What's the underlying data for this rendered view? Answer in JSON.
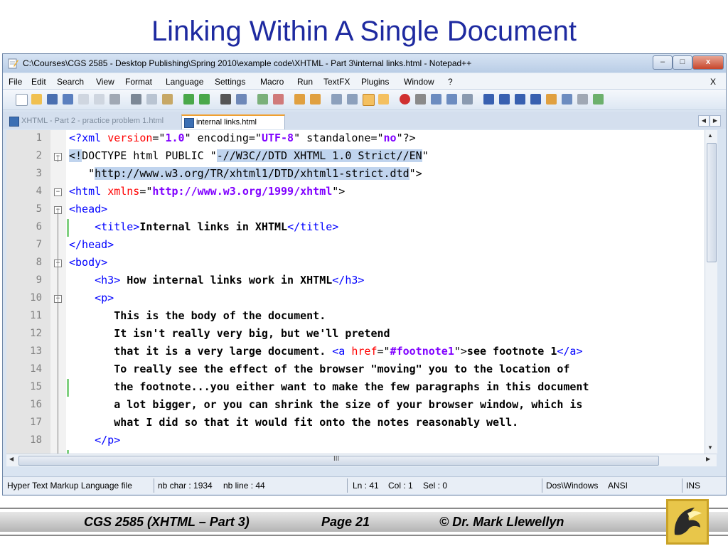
{
  "slide": {
    "title": "Linking Within A Single Document"
  },
  "window": {
    "title": "C:\\Courses\\CGS 2585 - Desktop Publishing\\Spring 2010\\example code\\XHTML - Part 3\\internal links.html - Notepad++",
    "controls": {
      "minimize": "–",
      "maximize": "□",
      "close": "x"
    }
  },
  "menu": {
    "items": [
      "File",
      "Edit",
      "Search",
      "View",
      "Format",
      "Language",
      "Settings",
      "Macro",
      "Run",
      "TextFX",
      "Plugins",
      "Window",
      "?"
    ],
    "close_doc": "X"
  },
  "tabs": [
    {
      "label": "XHTML - Part 2 - practice problem 1.html",
      "active": false
    },
    {
      "label": "internal links.html",
      "active": true
    }
  ],
  "editor": {
    "line_numbers": [
      "1",
      "2",
      "3",
      "4",
      "5",
      "6",
      "7",
      "8",
      "9",
      "10",
      "11",
      "12",
      "13",
      "14",
      "15",
      "16",
      "17",
      "18"
    ],
    "lines": [
      [
        {
          "t": "<?",
          "c": "tag"
        },
        {
          "t": "xml ",
          "c": "tag"
        },
        {
          "t": "version",
          "c": "attr"
        },
        {
          "t": "=\"",
          "c": ""
        },
        {
          "t": "1.0",
          "c": "val"
        },
        {
          "t": "\" encoding=\"",
          "c": ""
        },
        {
          "t": "UTF-8",
          "c": "val"
        },
        {
          "t": "\" standalone=\"",
          "c": ""
        },
        {
          "t": "no",
          "c": "val"
        },
        {
          "t": "\"?>",
          "c": ""
        }
      ],
      [
        {
          "t": "<!",
          "c": "sel"
        },
        {
          "t": "DOCTYPE html PUBLIC \"",
          "c": ""
        },
        {
          "t": "-//W3C//DTD XHTML 1.0 Strict//EN",
          "c": "sel"
        },
        {
          "t": "\"",
          "c": ""
        }
      ],
      [
        {
          "t": "   \"",
          "c": ""
        },
        {
          "t": "http://www.w3.org/TR/xhtml1/DTD/xhtml1-strict.dtd",
          "c": "sel"
        },
        {
          "t": "\">",
          "c": ""
        }
      ],
      [
        {
          "t": "<html ",
          "c": "tag"
        },
        {
          "t": "xmlns",
          "c": "attr"
        },
        {
          "t": "=\"",
          "c": ""
        },
        {
          "t": "http://www.w3.org/1999/xhtml",
          "c": "val"
        },
        {
          "t": "\">",
          "c": ""
        }
      ],
      [
        {
          "t": "<head>",
          "c": "tag"
        }
      ],
      [
        {
          "t": "    ",
          "c": ""
        },
        {
          "t": "<title>",
          "c": "tag"
        },
        {
          "t": "Internal links in XHTML",
          "c": "bold"
        },
        {
          "t": "</title>",
          "c": "tag"
        }
      ],
      [
        {
          "t": "</head>",
          "c": "tag"
        }
      ],
      [
        {
          "t": "<body>",
          "c": "tag"
        }
      ],
      [
        {
          "t": "    ",
          "c": ""
        },
        {
          "t": "<h3>",
          "c": "tag"
        },
        {
          "t": " How internal links work in XHTML",
          "c": "bold"
        },
        {
          "t": "</h3>",
          "c": "tag"
        }
      ],
      [
        {
          "t": "    ",
          "c": ""
        },
        {
          "t": "<p>",
          "c": "tag"
        }
      ],
      [
        {
          "t": "       This is the body of the document.",
          "c": "bold"
        }
      ],
      [
        {
          "t": "       It isn't really very big, but we'll pretend",
          "c": "bold"
        }
      ],
      [
        {
          "t": "       that it is a very large document. ",
          "c": "bold"
        },
        {
          "t": "<a ",
          "c": "tag"
        },
        {
          "t": "href",
          "c": "attr"
        },
        {
          "t": "=\"",
          "c": ""
        },
        {
          "t": "#footnote1",
          "c": "val"
        },
        {
          "t": "\">",
          "c": ""
        },
        {
          "t": "see footnote 1",
          "c": "bold"
        },
        {
          "t": "</a>",
          "c": "tag"
        }
      ],
      [
        {
          "t": "       To really see the effect of the browser \"moving\" you to the location of",
          "c": "bold"
        }
      ],
      [
        {
          "t": "       the footnote...you either want to make the few paragraphs in this document",
          "c": "bold"
        }
      ],
      [
        {
          "t": "       a lot bigger, or you can shrink the size of your browser window, which is",
          "c": "bold"
        }
      ],
      [
        {
          "t": "       what I did so that it would fit onto the notes reasonably well.",
          "c": "bold"
        }
      ],
      [
        {
          "t": "    ",
          "c": ""
        },
        {
          "t": "</p>",
          "c": "tag"
        }
      ]
    ],
    "fold_markers": [
      "",
      "⊟",
      "",
      "⊟",
      "⊟",
      "",
      "",
      "⊟",
      "",
      "⊟",
      "",
      "",
      "",
      "",
      "",
      "",
      "",
      ""
    ]
  },
  "scrollbar": {
    "h_grip": "III"
  },
  "status": {
    "file_type": "Hyper Text Markup Language file",
    "nb_char": "nb char : 1934",
    "nb_line": "nb line : 44",
    "ln": "Ln : 41",
    "col": "Col : 1",
    "sel": "Sel : 0",
    "eol": "Dos\\Windows",
    "encoding": "ANSI",
    "mode": "INS"
  },
  "footer": {
    "course": "CGS 2585 (XHTML – Part 3)",
    "page": "Page 21",
    "author": "© Dr. Mark Llewellyn"
  },
  "colors": {
    "title": "#1e2aa0",
    "tag": "#0000ff",
    "attr": "#ff0000",
    "value": "#8000ff",
    "selection": "#c0d4ee"
  }
}
